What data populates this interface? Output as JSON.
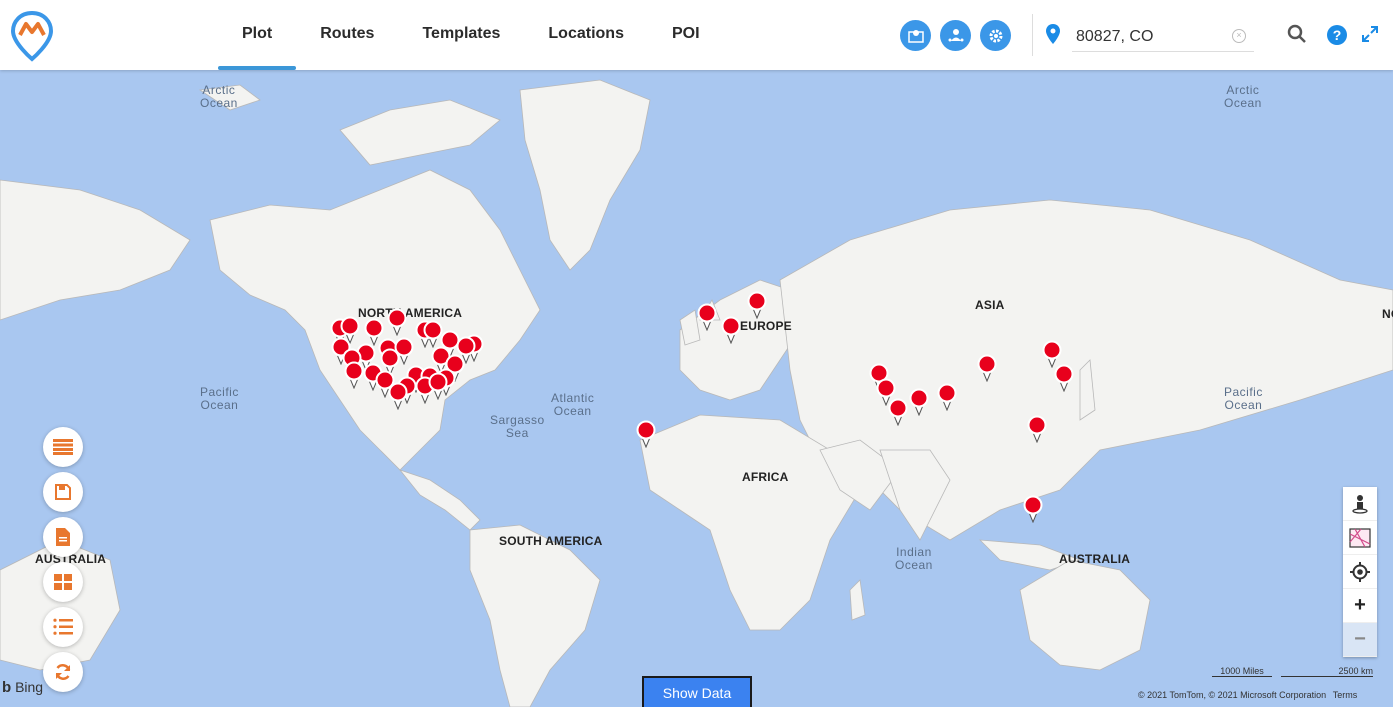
{
  "header": {
    "nav_tabs": [
      {
        "label": "Plot",
        "active": true
      },
      {
        "label": "Routes"
      },
      {
        "label": "Templates"
      },
      {
        "label": "Locations"
      },
      {
        "label": "POI"
      }
    ],
    "tool_icons": [
      "map-layer-icon",
      "territory-user-icon",
      "settings-icon"
    ],
    "location_input": "80827, CO",
    "help_label": "?"
  },
  "map": {
    "ocean_labels": [
      {
        "name": "arctic-ocean-left",
        "text": "Arctic\nOcean"
      },
      {
        "name": "arctic-ocean-right",
        "text": "Arctic\nOcean"
      },
      {
        "name": "pacific-ocean-left",
        "text": "Pacific\nOcean"
      },
      {
        "name": "pacific-ocean-right",
        "text": "Pacific\nOcean"
      },
      {
        "name": "atlantic-ocean",
        "text": "Atlantic\nOcean"
      },
      {
        "name": "sargasso-sea",
        "text": "Sargasso\nSea"
      },
      {
        "name": "indian-ocean",
        "text": "Indian\nOcean"
      }
    ],
    "continent_labels": [
      {
        "name": "north-america",
        "text": "NORTH AMERICA"
      },
      {
        "name": "south-america",
        "text": "SOUTH AMERICA"
      },
      {
        "name": "europe",
        "text": "EUROPE"
      },
      {
        "name": "asia",
        "text": "ASIA"
      },
      {
        "name": "africa",
        "text": "AFRICA"
      },
      {
        "name": "australia-right",
        "text": "AUSTRALIA"
      },
      {
        "name": "australia-left",
        "text": "AUSTRALIA"
      },
      {
        "name": "north-edge",
        "text": "NO"
      }
    ],
    "pin_color": "#e8001c",
    "attribution": "Bing",
    "scale_miles": "1000 Miles",
    "scale_km": "2500 km",
    "copyright": "© 2021 TomTom, © 2021 Microsoft Corporation",
    "terms": "Terms"
  },
  "side_buttons": [
    "list-icon",
    "save-icon",
    "document-icon",
    "grid-icon",
    "numbered-list-icon",
    "refresh-icon"
  ],
  "map_controls": [
    "street-view-icon",
    "map-style-icon",
    "locate-icon",
    "zoom-in",
    "zoom-out"
  ],
  "zoom_in_label": "+",
  "zoom_out_label": "−",
  "show_data_label": "Show Data",
  "colors": {
    "accent": "#3b97e8",
    "orange": "#e8772e",
    "land": "#f2f2f0",
    "water": "#a9c7f0"
  }
}
